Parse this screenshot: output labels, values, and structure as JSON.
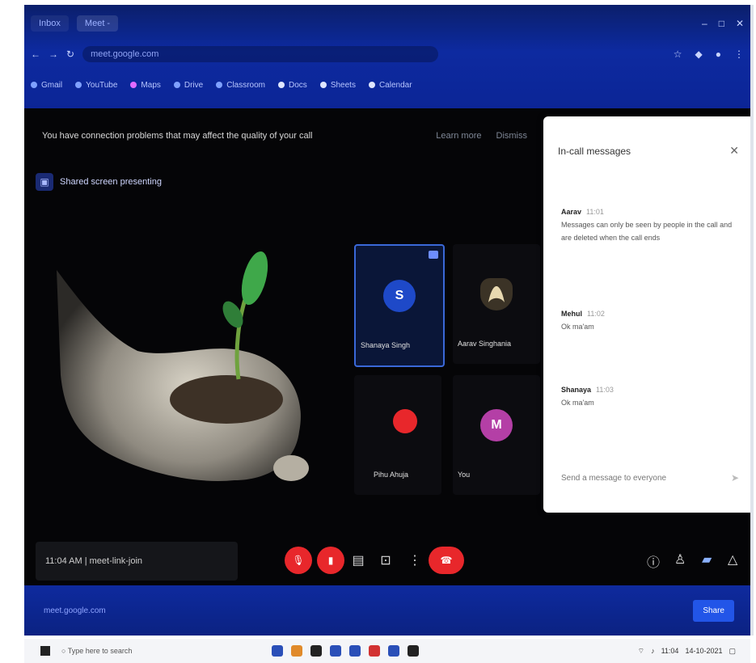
{
  "browser": {
    "tabs": [
      {
        "label": "Inbox",
        "active": false
      },
      {
        "label": "Meet - ",
        "active": true
      }
    ],
    "window_controls": [
      "–",
      "□",
      "✕"
    ],
    "url": "meet.google.com",
    "bookmarks": [
      "Gmail",
      "YouTube",
      "Maps",
      "Drive",
      "Classroom",
      "Docs",
      "Sheets",
      "Calendar"
    ]
  },
  "meeting": {
    "banner": {
      "message": "You have connection problems that may affect the quality of your call",
      "actions": [
        "Learn more",
        "Dismiss"
      ]
    },
    "presenting_label": "Shared screen presenting",
    "participants": [
      {
        "name": "Shanaya Singh",
        "initial": "S",
        "avatar_color": "#1e49c8",
        "selected": true
      },
      {
        "name": "Aarav Singhania",
        "initial": "",
        "avatar_color": "#3b3326",
        "selected": false
      },
      {
        "name": "Pihu Ahuja",
        "initial": "",
        "avatar_color": "#e8272b",
        "selected": false
      },
      {
        "name": "You",
        "initial": "M",
        "avatar_color": "#b43fa6",
        "selected": false
      }
    ],
    "meeting_info": "11:04 AM | meet-link-join",
    "toolbar_icons": [
      "mic-off",
      "camera-off",
      "captions",
      "present",
      "more",
      "leave-call"
    ],
    "right_icons": [
      "info",
      "people",
      "chat",
      "activities"
    ]
  },
  "chat": {
    "title": "In-call messages",
    "messages": [
      {
        "sender": "Aarav",
        "time": "11:01",
        "text": "Messages can only be seen by people in the call and are deleted when the call ends"
      },
      {
        "sender": "Mehul",
        "time": "11:02",
        "text": "Ok ma'am"
      },
      {
        "sender": "Shanaya",
        "time": "11:03",
        "text": "Ok ma'am"
      }
    ],
    "send_placeholder": "Send a message to everyone"
  },
  "bottom_bar": {
    "left_text": "meet.google.com",
    "button": "Share"
  },
  "taskbar": {
    "search_placeholder": "Type here to search",
    "time": "11:04",
    "date": "14-10-2021"
  }
}
